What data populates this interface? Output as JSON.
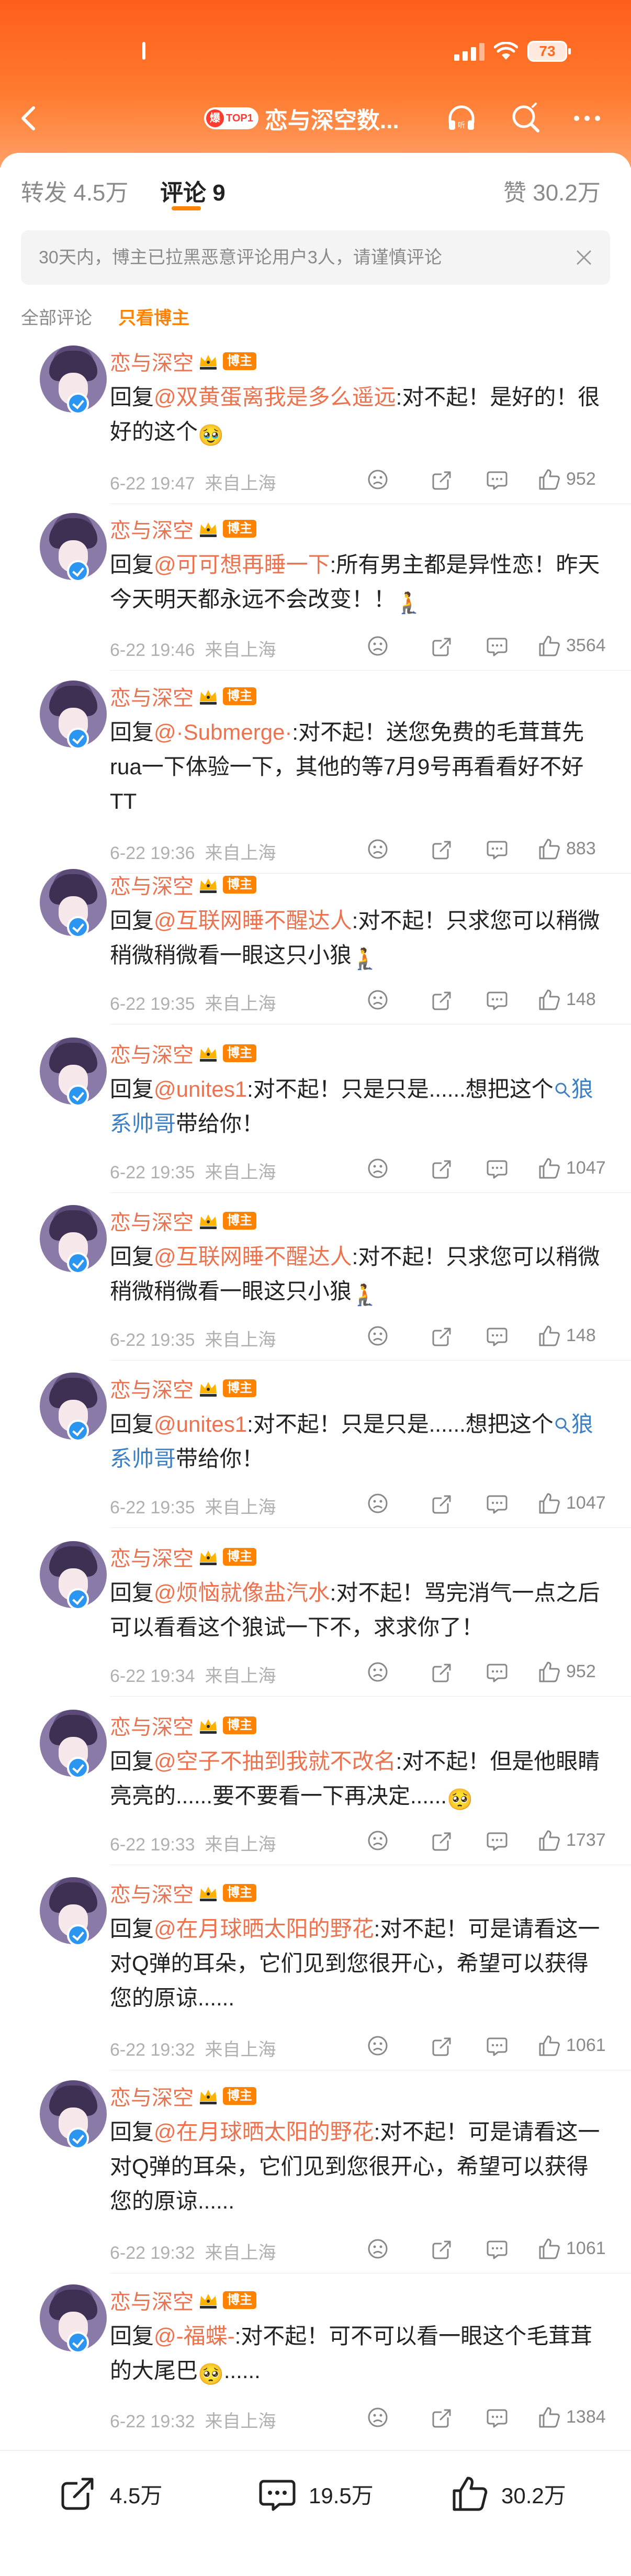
{
  "status_bar": {
    "battery": "73"
  },
  "header": {
    "hot_badge_fire": "爆",
    "hot_badge_label": "TOP1",
    "title": "恋与深空数..."
  },
  "tabs": [
    {
      "label": "转发 4.5万"
    },
    {
      "label": "评论 9"
    },
    {
      "label": "赞 30.2万"
    }
  ],
  "notice": "30天内，博主已拉黑恶意评论用户3人，请谨慎评论",
  "filters": {
    "all": "全部评论",
    "host_only": "只看博主"
  },
  "host_tag": "博主",
  "comments": [
    {
      "user": "恋与深空",
      "prefix": "回复",
      "mention": "@双黄蛋离我是多么遥远",
      "text": ":对不起！是好的！很好的这个",
      "emoji": "🥹",
      "time": "6-22 19:47",
      "location": "来自上海",
      "likes": "952"
    },
    {
      "user": "恋与深空",
      "prefix": "回复",
      "mention": "@可可想再睡一下",
      "text": ":所有男主都是异性恋！昨天今天明天都永远不会改变！！",
      "emoji": "🧎",
      "time": "6-22 19:46",
      "location": "来自上海",
      "likes": "3564"
    },
    {
      "user": "恋与深空",
      "prefix": "回复",
      "mention": "@·Submerge·",
      "text": ":对不起！送您免费的毛茸茸先rua一下体验一下，其他的等7月9号再看看好不好TT",
      "emoji": "",
      "time": "6-22 19:36",
      "location": "来自上海",
      "likes": "883"
    },
    {
      "user": "恋与深空",
      "prefix": "回复",
      "mention": "@互联网睡不醒达人",
      "text": ":对不起！只求您可以稍微稍微稍微看一眼这只小狼",
      "emoji": "🧎",
      "time": "6-22 19:35",
      "location": "来自上海",
      "likes": "148"
    },
    {
      "user": "恋与深空",
      "prefix": "回复",
      "mention": "@unites1",
      "text": ":对不起！只是只是......想把这个",
      "link": "狼系帅哥",
      "suffix": "带给你！",
      "time": "6-22 19:35",
      "location": "来自上海",
      "likes": "1047"
    },
    {
      "user": "恋与深空",
      "prefix": "回复",
      "mention": "@互联网睡不醒达人",
      "text": ":对不起！只求您可以稍微稍微稍微看一眼这只小狼",
      "emoji": "🧎",
      "time": "6-22 19:35",
      "location": "来自上海",
      "likes": "148"
    },
    {
      "user": "恋与深空",
      "prefix": "回复",
      "mention": "@unites1",
      "text": ":对不起！只是只是......想把这个",
      "link": "狼系帅哥",
      "suffix": "带给你！",
      "time": "6-22 19:35",
      "location": "来自上海",
      "likes": "1047"
    },
    {
      "user": "恋与深空",
      "prefix": "回复",
      "mention": "@烦恼就像盐汽水",
      "text": ":对不起！骂完消气一点之后可以看看这个狼试一下不，求求你了！",
      "emoji": "",
      "time": "6-22 19:34",
      "location": "来自上海",
      "likes": "952"
    },
    {
      "user": "恋与深空",
      "prefix": "回复",
      "mention": "@空子不抽到我就不改名",
      "text": ":对不起！但是他眼睛亮亮的......要不要看一下再决定......",
      "emoji": "🥺",
      "time": "6-22 19:33",
      "location": "来自上海",
      "likes": "1737"
    },
    {
      "user": "恋与深空",
      "prefix": "回复",
      "mention": "@在月球晒太阳的野花",
      "text": ":对不起！可是请看这一对Q弹的耳朵，它们见到您很开心，希望可以获得您的原谅......",
      "emoji": "",
      "time": "6-22 19:32",
      "location": "来自上海",
      "likes": "1061"
    },
    {
      "user": "恋与深空",
      "prefix": "回复",
      "mention": "@在月球晒太阳的野花",
      "text": ":对不起！可是请看这一对Q弹的耳朵，它们见到您很开心，希望可以获得您的原谅......",
      "emoji": "",
      "time": "6-22 19:32",
      "location": "来自上海",
      "likes": "1061"
    },
    {
      "user": "恋与深空",
      "prefix": "回复",
      "mention": "@-福蝶-",
      "text": ":对不起！可不可以看一眼这个毛茸茸的大尾巴",
      "emoji": "🥺",
      "suffix": "......",
      "time": "6-22 19:32",
      "location": "来自上海",
      "likes": "1384"
    }
  ],
  "bottom_bar": {
    "repost": "4.5万",
    "comment": "19.5万",
    "like": "30.2万"
  },
  "colors": {
    "accent": "#ff8200",
    "username": "#eb7350",
    "link": "#3d7fc4",
    "header": "#ff6a1f"
  }
}
